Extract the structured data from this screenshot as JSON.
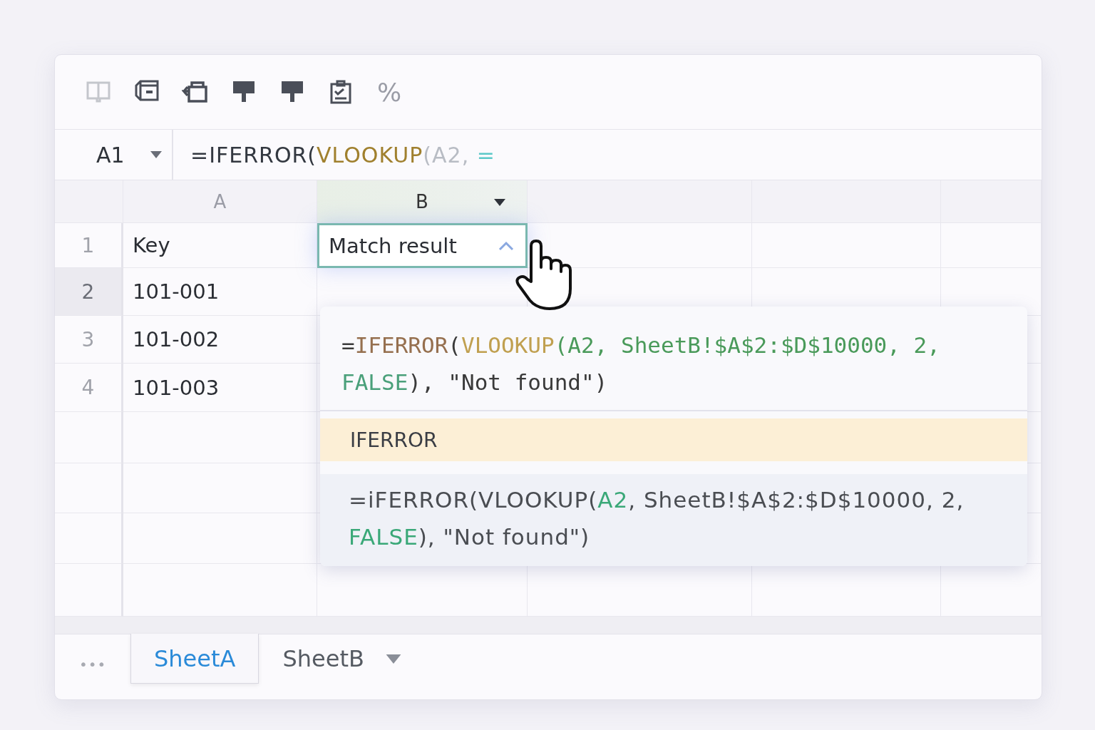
{
  "toolbar": [
    {
      "kind": "book",
      "disabled": true
    },
    {
      "kind": "box",
      "disabled": false
    },
    {
      "kind": "print",
      "disabled": false
    },
    {
      "kind": "paint",
      "disabled": false
    },
    {
      "kind": "paint",
      "disabled": false
    },
    {
      "kind": "clipboard",
      "disabled": false
    },
    {
      "kind": "percent",
      "label": "%",
      "disabled": false
    }
  ],
  "formula_bar": {
    "cell_ref": "A1",
    "tokens": [
      {
        "text": "=IFERROR(",
        "color": "#333840"
      },
      {
        "text": "VLOOKUP",
        "color": "#a0802e"
      },
      {
        "text": "(A2, ",
        "color": "#b8bcc4"
      },
      {
        "text": "=",
        "color": "#5cc8c8"
      }
    ]
  },
  "columns": [
    {
      "label": "A",
      "selected": false,
      "menu": false
    },
    {
      "label": "B",
      "selected": true,
      "menu": true
    }
  ],
  "rows": [
    {
      "number": "1",
      "selected": false,
      "cells": [
        {
          "text": "Key",
          "editing": false
        },
        {
          "text": "Match result",
          "editing": true
        }
      ]
    },
    {
      "number": "2",
      "selected": true,
      "cells": [
        {
          "text": "101-001",
          "editing": false
        }
      ]
    },
    {
      "number": "3",
      "selected": false,
      "cells": [
        {
          "text": "101-002",
          "editing": false
        }
      ]
    },
    {
      "number": "4",
      "selected": false,
      "cells": [
        {
          "text": "101-003",
          "editing": false
        }
      ]
    }
  ],
  "autocomplete": {
    "preview_tokens": [
      {
        "text": "=",
        "color": "#3a3a3a"
      },
      {
        "text": "IFERROR",
        "color": "#96704f"
      },
      {
        "text": "(",
        "color": "#3a3a3a"
      },
      {
        "text": "VLOOKUP",
        "color": "#c0a050"
      },
      {
        "text": "(A2, SheetB!$A$2:$D$10000, 2, ",
        "color": "#4a9a5a"
      },
      {
        "text": "FALSE",
        "color": "#4aa07a"
      },
      {
        "text": "), \"Not found\")",
        "color": "#3a3a3a"
      }
    ],
    "suggestions": [
      {
        "name": "IFERROR",
        "selected": true
      }
    ],
    "hint_tokens": [
      {
        "text": "=iFERROR(VLOOKUP(",
        "color": "#4a4d52"
      },
      {
        "text": "A2",
        "color": "#3aa878"
      },
      {
        "text": ", SheetB!$A$2:$D$10000, 2, ",
        "color": "#4a4d52"
      },
      {
        "text": "FALSE",
        "color": "#3aa878"
      },
      {
        "text": "), \"Not found\")",
        "color": "#4a4d52"
      }
    ]
  },
  "sheet_tabs": [
    {
      "label": "SheetA",
      "selected": true,
      "menu": false
    },
    {
      "label": "SheetB",
      "selected": false,
      "menu": true
    }
  ],
  "more": "•••"
}
